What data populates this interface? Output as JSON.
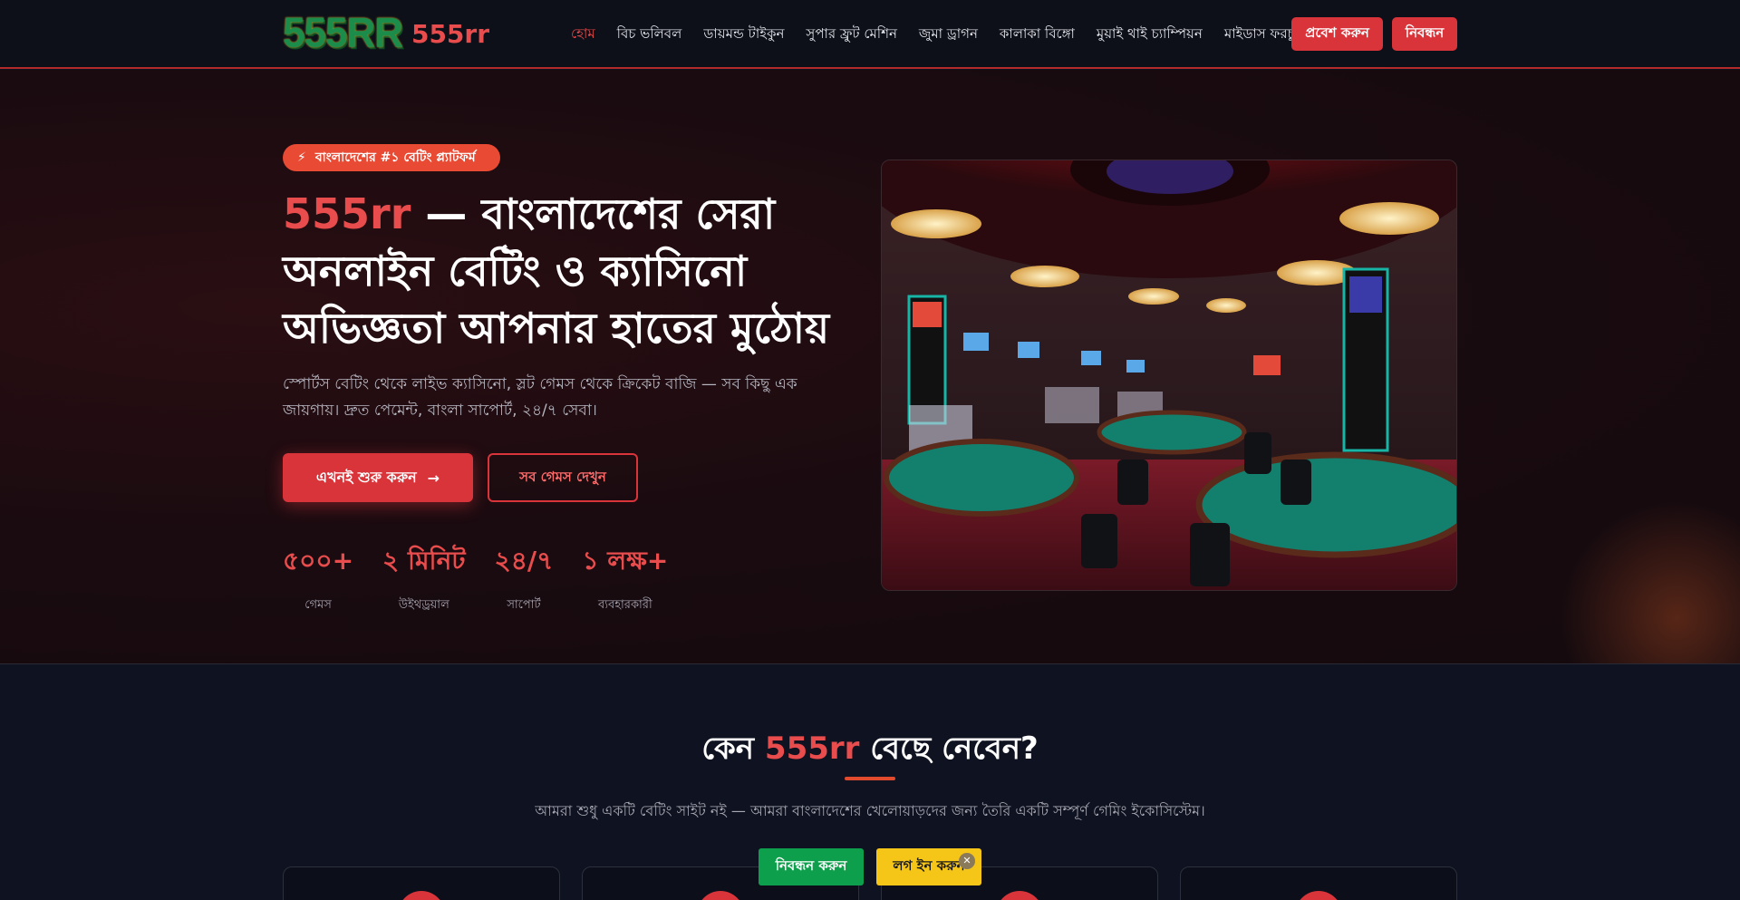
{
  "header": {
    "logo_mark": "555RR",
    "logo_text": "555rr",
    "nav": [
      {
        "label": "হোম",
        "active": true
      },
      {
        "label": "বিচ ভলিবল"
      },
      {
        "label": "ডায়মন্ড টাইকুন"
      },
      {
        "label": "সুপার ফ্রুট মেশিন"
      },
      {
        "label": "জুমা ড্রাগন"
      },
      {
        "label": "কালাকা বিঙ্গো"
      },
      {
        "label": "মুয়াই থাই চ্যাম্পিয়ন"
      },
      {
        "label": "মাইডাস ফরচুন"
      }
    ],
    "login_label": "প্রবেশ করুন",
    "register_label": "নিবন্ধন"
  },
  "hero": {
    "badge": "বাংলাদেশের #১ বেটিং প্ল্যাটফর্ম",
    "title_brand": "555rr",
    "title_rest": " — বাংলাদেশের সেরা অনলাইন বেটিং ও ক্যাসিনো অভিজ্ঞতা আপনার হাতের মুঠোয়",
    "subtitle": "স্পোর্টস বেটিং থেকে লাইভ ক্যাসিনো, স্লট গেমস থেকে ক্রিকেট বাজি — সব কিছু এক জায়গায়। দ্রুত পেমেন্ট, বাংলা সাপোর্ট, ২৪/৭ সেবা।",
    "cta_primary": "এখনই শুরু করুন",
    "cta_secondary": "সব গেমস দেখুন",
    "stats": [
      {
        "value": "৫০০+",
        "label": "গেমস"
      },
      {
        "value": "২ মিনিট",
        "label": "উইথড্রয়াল"
      },
      {
        "value": "২৪/৭",
        "label": "সাপোর্ট"
      },
      {
        "value": "১ লক্ষ+",
        "label": "ব্যবহারকারী"
      }
    ]
  },
  "why": {
    "title_pre": "কেন ",
    "title_brand": "555rr",
    "title_post": " বেছে নেবেন?",
    "subtitle": "আমরা শুধু একটি বেটিং সাইট নই — আমরা বাংলাদেশের খেলোয়াড়দের জন্য তৈরি একটি সম্পূর্ণ গেমিং ইকোসিস্টেম।"
  },
  "floating": {
    "register_label": "নিবন্ধন করুন",
    "login_label": "লগ ইন করুন",
    "close_glyph": "✕"
  },
  "colors": {
    "accent": "#d8343a",
    "brand_red": "#e84c4c",
    "green": "#0e9f4d",
    "yellow": "#f5c518"
  }
}
